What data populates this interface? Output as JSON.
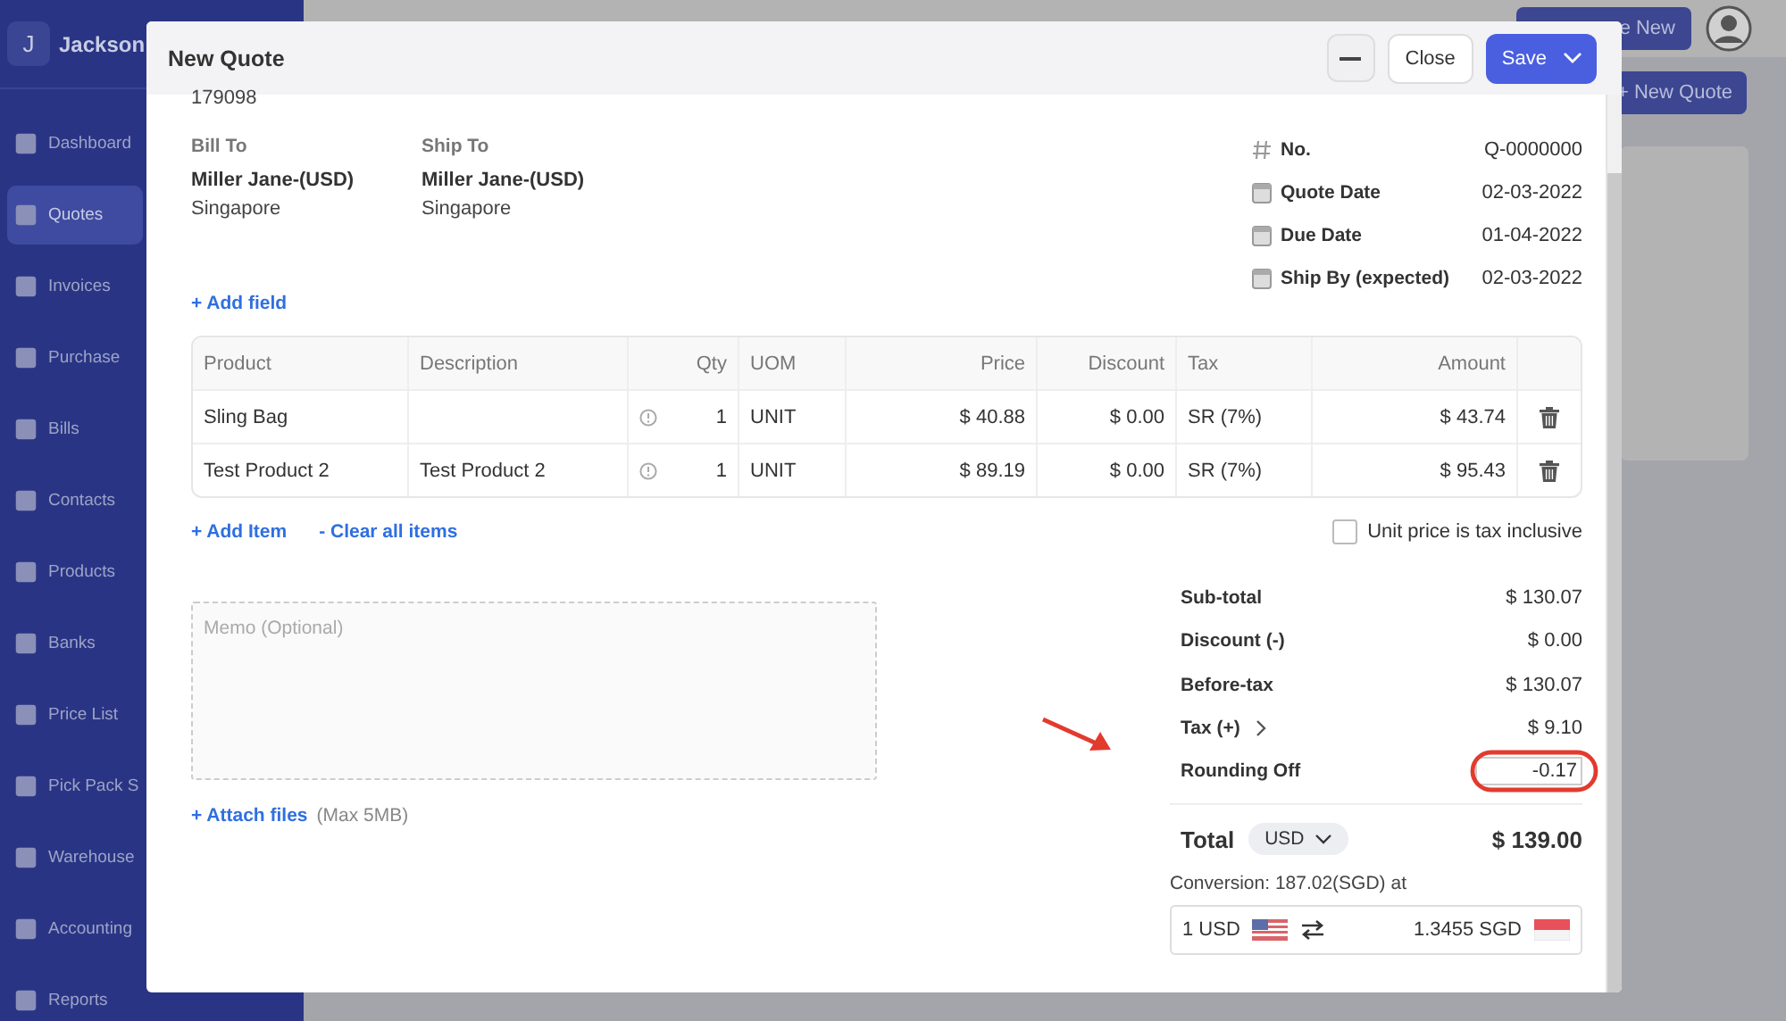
{
  "sidebar": {
    "brand_initial": "J",
    "brand_name": "Jackson",
    "items": [
      {
        "label": "Dashboard",
        "selected": false
      },
      {
        "label": "Quotes",
        "selected": true
      },
      {
        "label": "Invoices",
        "selected": false
      },
      {
        "label": "Purchase",
        "selected": false
      },
      {
        "label": "Bills",
        "selected": false
      },
      {
        "label": "Contacts",
        "selected": false
      },
      {
        "label": "Products",
        "selected": false
      },
      {
        "label": "Banks",
        "selected": false
      },
      {
        "label": "Price List",
        "selected": false
      },
      {
        "label": "Pick Pack S",
        "selected": false
      },
      {
        "label": "Warehouse",
        "selected": false
      },
      {
        "label": "Accounting",
        "selected": false
      },
      {
        "label": "Reports",
        "selected": false
      }
    ]
  },
  "top_bar": {
    "create_button": "e New"
  },
  "page": {
    "new_button": "+ New Quote"
  },
  "modal": {
    "title": "New Quote",
    "close_button": "Close",
    "save_button": "Save",
    "reference": "179098",
    "bill_to": {
      "label": "Bill To",
      "name": "Miller Jane-(USD)",
      "country": "Singapore"
    },
    "ship_to": {
      "label": "Ship To",
      "name": "Miller Jane-(USD)",
      "country": "Singapore"
    },
    "meta": [
      {
        "kind": "number",
        "label": "No.",
        "value": "Q-0000000"
      },
      {
        "kind": "date",
        "label": "Quote Date",
        "value": "02-03-2022"
      },
      {
        "kind": "date",
        "label": "Due Date",
        "value": "01-04-2022"
      },
      {
        "kind": "date",
        "label": "Ship By (expected)",
        "value": "02-03-2022"
      }
    ],
    "add_field": "+ Add field",
    "table": {
      "columns": [
        "Product",
        "Description",
        "Qty",
        "UOM",
        "Price",
        "Discount",
        "Tax",
        "Amount"
      ],
      "rows": [
        {
          "product": "Sling Bag",
          "qty": "1",
          "uom": "UNIT",
          "price": "$ 40.88",
          "discount": "$ 0.00",
          "tax": "SR (7%)",
          "amount": "$ 43.74"
        },
        {
          "product": "Test Product 2",
          "description": "Test Product 2",
          "qty": "1",
          "uom": "UNIT",
          "price": "$ 89.19",
          "discount": "$ 0.00",
          "tax": "SR (7%)",
          "amount": "$ 95.43"
        }
      ]
    },
    "add_item": "+ Add Item",
    "clear_items": "- Clear all items",
    "tax_inclusive": {
      "label": "Unit price is tax inclusive",
      "checked": false
    },
    "memo": {
      "placeholder": "Memo (Optional)"
    },
    "attach": {
      "link": "+ Attach files",
      "note": "(Max 5MB)"
    },
    "totals": [
      {
        "kind": "amount",
        "label": "Sub-total",
        "value": "$ 130.07"
      },
      {
        "kind": "amount",
        "label": "Discount (-)",
        "value": "$ 0.00"
      },
      {
        "kind": "amount",
        "label": "Before-tax",
        "value": "$ 130.07"
      },
      {
        "kind": "expandable",
        "label": "Tax (+)",
        "value": "$ 9.10"
      },
      {
        "kind": "input",
        "label": "Rounding Off",
        "value": "-0.17"
      }
    ],
    "total": {
      "label": "Total",
      "currency": "USD",
      "value": "$ 139.00"
    },
    "conversion": {
      "text": "Conversion: 187.02(SGD) at",
      "from": "1 USD",
      "to": "1.3455 SGD"
    }
  }
}
